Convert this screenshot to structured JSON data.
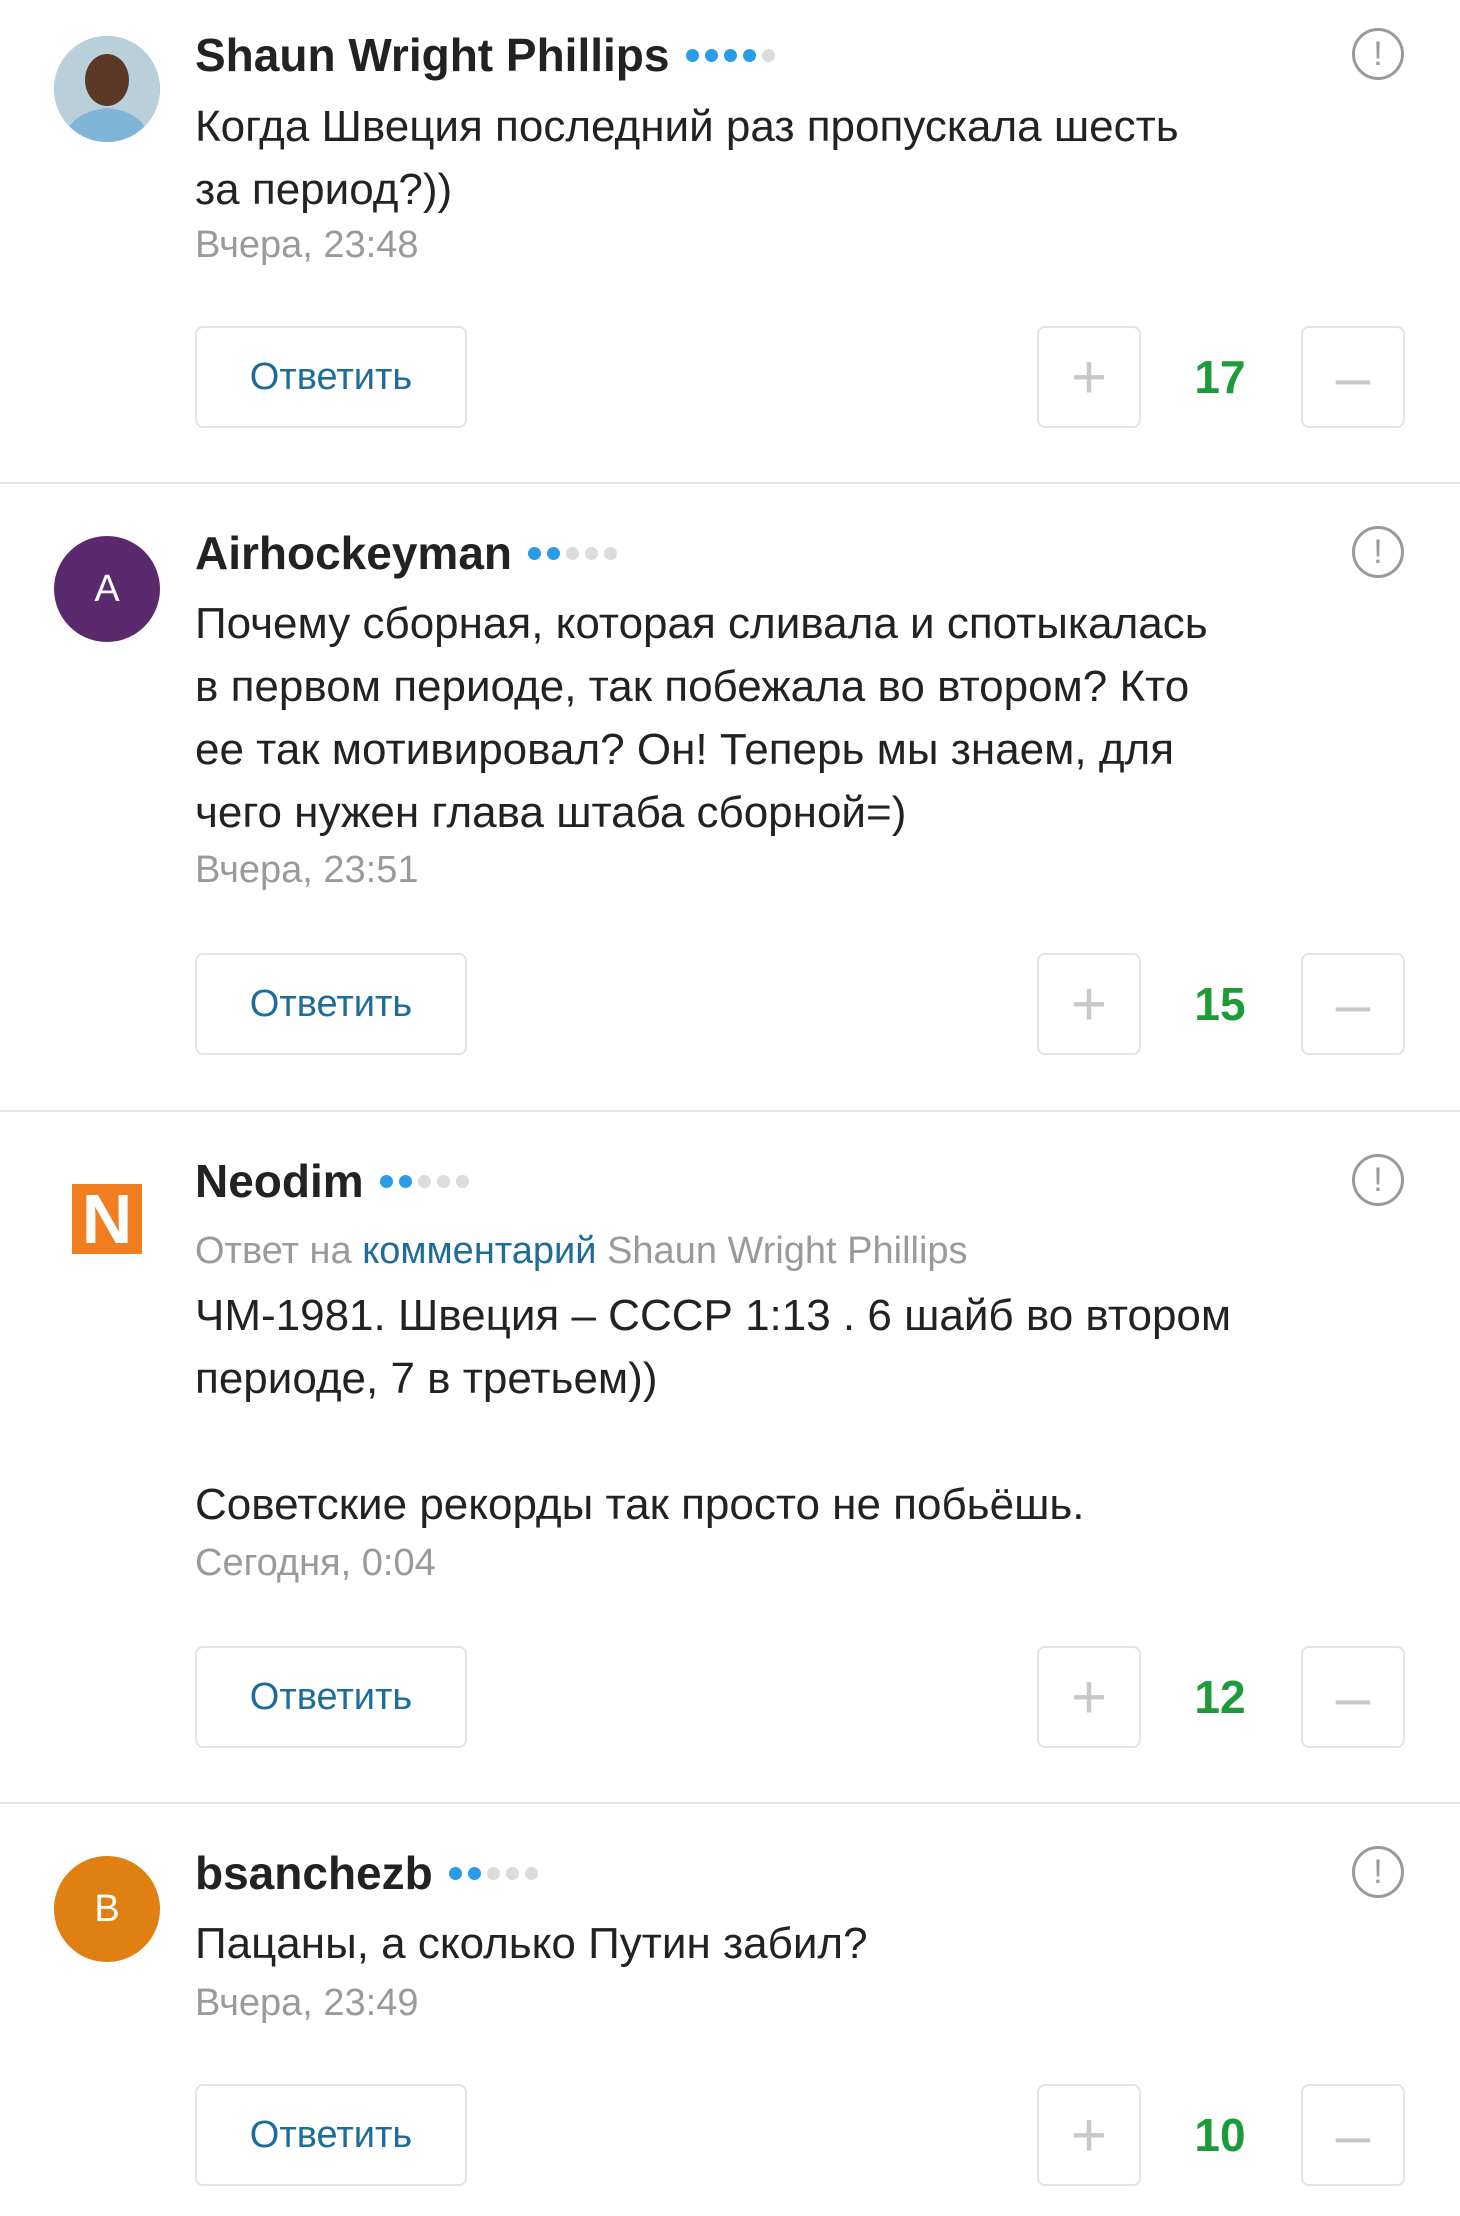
{
  "comments": [
    {
      "username": "Shaun Wright Phillips",
      "rating_filled": 4,
      "avatar": {
        "type": "photo",
        "letter": "",
        "color": "#8ab2c8"
      },
      "reply_to": null,
      "text": "Когда Швеция последний раз пропускала шесть\nза период?))",
      "time": "Вчера, 23:48",
      "reply_label": "Ответить",
      "score": "17"
    },
    {
      "username": "Airhockeyman",
      "rating_filled": 2,
      "avatar": {
        "type": "letter",
        "letter": "A",
        "color": "#5b2a6e"
      },
      "reply_to": null,
      "text": "Почему сборная, которая сливала и спотыкалась\nв первом периоде, так побежала во втором? Кто\nее так мотивировал? Он! Теперь мы знаем, для\nчего нужен глава штаба сборной=)",
      "time": "Вчера, 23:51",
      "reply_label": "Ответить",
      "score": "15"
    },
    {
      "username": "Neodim",
      "rating_filled": 2,
      "avatar": {
        "type": "letter-square",
        "letter": "N",
        "color": "#f07d1e"
      },
      "reply_to": {
        "prefix": "Ответ на",
        "link": "комментарий",
        "author": "Shaun Wright Phillips"
      },
      "text": "ЧМ-1981. Швеция – СССР 1:13 . 6 шайб во втором\nпериоде, 7 в третьем))\n\nСоветские рекорды так просто не побьёшь.",
      "time": "Сегодня, 0:04",
      "reply_label": "Ответить",
      "score": "12"
    },
    {
      "username": "bsanchezb",
      "rating_filled": 2,
      "avatar": {
        "type": "letter",
        "letter": "B",
        "color": "#e07f12"
      },
      "reply_to": null,
      "text": "Пацаны, а сколько Путин забил?",
      "time": "Вчера, 23:49",
      "reply_label": "Ответить",
      "score": "10"
    }
  ],
  "icons": {
    "report": "exclamation-circle-icon",
    "plus": "plus-icon",
    "minus": "minus-icon"
  },
  "colors": {
    "score": "#1d9a3a",
    "link": "#1e6c99",
    "rating_on": "#2a9be6",
    "rating_off": "#dcdcdc"
  }
}
